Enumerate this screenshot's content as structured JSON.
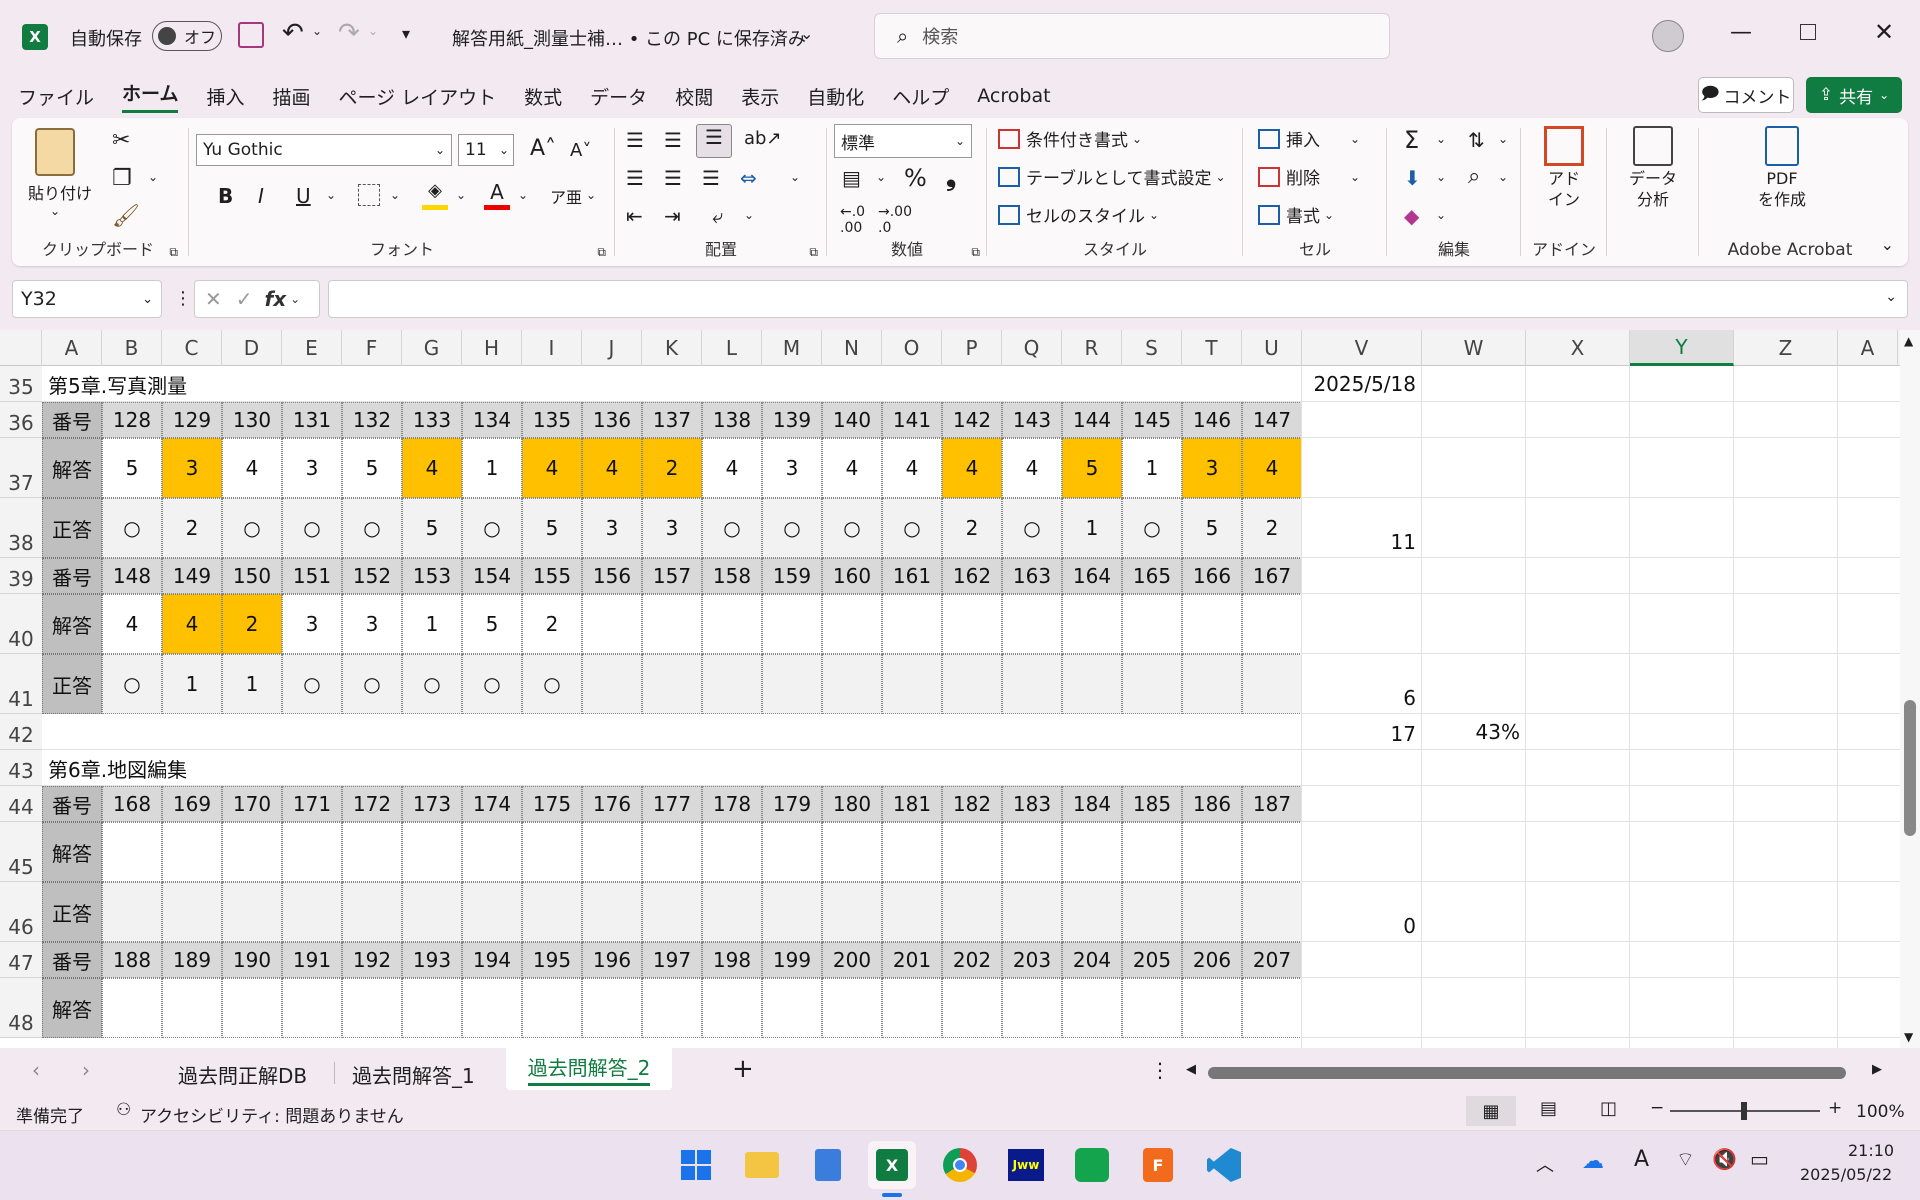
{
  "titlebar": {
    "autosave_label": "自動保存",
    "autosave_state": "オフ",
    "doc_title": "解答用紙_測量士補… • この PC に保存済み",
    "search_placeholder": "検索"
  },
  "menu": [
    "ファイル",
    "ホーム",
    "挿入",
    "描画",
    "ページ レイアウト",
    "数式",
    "データ",
    "校閲",
    "表示",
    "自動化",
    "ヘルプ",
    "Acrobat"
  ],
  "menu_active": "ホーム",
  "comment_label": "コメント",
  "share_label": "共有",
  "ribbon": {
    "clipboard": {
      "paste": "貼り付け",
      "label": "クリップボード"
    },
    "font": {
      "name": "Yu Gothic",
      "size": "11",
      "label": "フォント"
    },
    "alignment": {
      "label": "配置"
    },
    "number": {
      "format": "標準",
      "label": "数値"
    },
    "styles": {
      "cond": "条件付き書式",
      "table": "テーブルとして書式設定",
      "cell": "セルのスタイル",
      "label": "スタイル"
    },
    "cells": {
      "insert": "挿入",
      "delete": "削除",
      "format": "書式",
      "label": "セル"
    },
    "edit": {
      "label": "編集"
    },
    "addin": {
      "name": "アド\nイン",
      "label": "アドイン"
    },
    "analyze": {
      "name": "データ\n分析"
    },
    "acrobat": {
      "name": "PDF\nを作成",
      "label": "Adobe Acrobat"
    }
  },
  "formula": {
    "namebox": "Y32",
    "fx": "fx",
    "content": ""
  },
  "columns": [
    "A",
    "B",
    "C",
    "D",
    "E",
    "F",
    "G",
    "H",
    "I",
    "J",
    "K",
    "L",
    "M",
    "N",
    "O",
    "P",
    "Q",
    "R",
    "S",
    "T",
    "U",
    "V",
    "W",
    "X",
    "Y",
    "Z",
    "A"
  ],
  "rows": {
    "r35": {
      "num": "35",
      "title": "第5章.写真測量",
      "date": "2025/5/18"
    },
    "r36": {
      "num": "36",
      "label": "番号",
      "values": [
        "128",
        "129",
        "130",
        "131",
        "132",
        "133",
        "134",
        "135",
        "136",
        "137",
        "138",
        "139",
        "140",
        "141",
        "142",
        "143",
        "144",
        "145",
        "146",
        "147"
      ]
    },
    "r37": {
      "num": "37",
      "label": "解答",
      "values": [
        "5",
        "3",
        "4",
        "3",
        "5",
        "4",
        "1",
        "4",
        "4",
        "2",
        "4",
        "3",
        "4",
        "4",
        "4",
        "4",
        "5",
        "1",
        "3",
        "4"
      ],
      "highlight": [
        false,
        true,
        false,
        false,
        false,
        true,
        false,
        true,
        true,
        true,
        false,
        false,
        false,
        false,
        true,
        false,
        true,
        false,
        true,
        true
      ]
    },
    "r38": {
      "num": "38",
      "label": "正答",
      "values": [
        "○",
        "2",
        "○",
        "○",
        "○",
        "5",
        "○",
        "5",
        "3",
        "3",
        "○",
        "○",
        "○",
        "○",
        "2",
        "○",
        "1",
        "○",
        "5",
        "2"
      ],
      "v": "11"
    },
    "r39": {
      "num": "39",
      "label": "番号",
      "values": [
        "148",
        "149",
        "150",
        "151",
        "152",
        "153",
        "154",
        "155",
        "156",
        "157",
        "158",
        "159",
        "160",
        "161",
        "162",
        "163",
        "164",
        "165",
        "166",
        "167"
      ]
    },
    "r40": {
      "num": "40",
      "label": "解答",
      "values": [
        "4",
        "4",
        "2",
        "3",
        "3",
        "1",
        "5",
        "2",
        "",
        "",
        "",
        "",
        "",
        "",
        "",
        "",
        "",
        "",
        "",
        ""
      ],
      "highlight": [
        false,
        true,
        true,
        false,
        false,
        false,
        false,
        false,
        false,
        false,
        false,
        false,
        false,
        false,
        false,
        false,
        false,
        false,
        false,
        false
      ]
    },
    "r41": {
      "num": "41",
      "label": "正答",
      "values": [
        "○",
        "1",
        "1",
        "○",
        "○",
        "○",
        "○",
        "○",
        "",
        "",
        "",
        "",
        "",
        "",
        "",
        "",
        "",
        "",
        "",
        ""
      ],
      "v": "6"
    },
    "r42": {
      "num": "42",
      "v": "17",
      "w": "43%"
    },
    "r43": {
      "num": "43",
      "title": "第6章.地図編集"
    },
    "r44": {
      "num": "44",
      "label": "番号",
      "values": [
        "168",
        "169",
        "170",
        "171",
        "172",
        "173",
        "174",
        "175",
        "176",
        "177",
        "178",
        "179",
        "180",
        "181",
        "182",
        "183",
        "184",
        "185",
        "186",
        "187"
      ]
    },
    "r45": {
      "num": "45",
      "label": "解答"
    },
    "r46": {
      "num": "46",
      "label": "正答",
      "v": "0"
    },
    "r47": {
      "num": "47",
      "label": "番号",
      "values": [
        "188",
        "189",
        "190",
        "191",
        "192",
        "193",
        "194",
        "195",
        "196",
        "197",
        "198",
        "199",
        "200",
        "201",
        "202",
        "203",
        "204",
        "205",
        "206",
        "207"
      ]
    },
    "r48": {
      "num": "48",
      "label": "解答"
    }
  },
  "sheets": [
    "過去問正解DB",
    "過去問解答_1",
    "過去問解答_2"
  ],
  "active_sheet": "過去問解答_2",
  "status": {
    "ready": "準備完了",
    "accessibility": "アクセシビリティ: 問題ありません",
    "zoom": "100%"
  },
  "clock": {
    "time": "21:10",
    "date": "2025/05/22"
  },
  "colors": {
    "highlight": "#ffc000",
    "header_gray": "#bfbfbf",
    "excel_green": "#107c41"
  }
}
